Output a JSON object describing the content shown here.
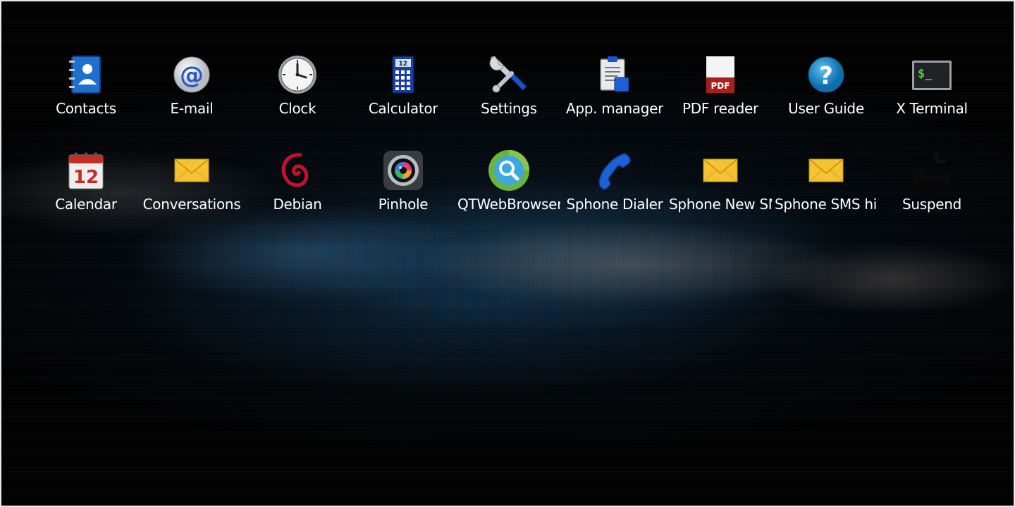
{
  "launcher": {
    "rows": [
      [
        {
          "label": "Contacts",
          "icon": "contacts-icon"
        },
        {
          "label": "E-mail",
          "icon": "email-at-icon"
        },
        {
          "label": "Clock",
          "icon": "clock-icon"
        },
        {
          "label": "Calculator",
          "icon": "calculator-icon",
          "icon_text": "12"
        },
        {
          "label": "Settings",
          "icon": "wrench-screwdriver-icon"
        },
        {
          "label": "App. manager",
          "icon": "clipboard-icon"
        },
        {
          "label": "PDF reader",
          "icon": "pdf-document-icon",
          "icon_text": "PDF"
        },
        {
          "label": "User Guide",
          "icon": "question-mark-icon",
          "icon_text": "?"
        },
        {
          "label": "X Terminal",
          "icon": "terminal-icon",
          "icon_text": "$_"
        }
      ],
      [
        {
          "label": "Calendar",
          "icon": "calendar-icon",
          "icon_text": "12"
        },
        {
          "label": "Conversations",
          "icon": "envelope-icon"
        },
        {
          "label": "Debian",
          "icon": "debian-swirl-icon"
        },
        {
          "label": "Pinhole",
          "icon": "camera-lens-icon"
        },
        {
          "label": "QTWebBrowser",
          "icon": "magnifier-globe-icon"
        },
        {
          "label": "Sphone Dialer",
          "icon": "phone-handset-icon"
        },
        {
          "label": "Sphone New SM-",
          "icon": "envelope-icon"
        },
        {
          "label": "Sphone SMS his-",
          "icon": "envelope-icon"
        },
        {
          "label": "Suspend",
          "icon": "bed-moon-icon"
        }
      ]
    ]
  },
  "colors": {
    "label_text": "#ffffff",
    "contacts_blue": "#1f6fd0",
    "pdf_red": "#a8201a",
    "help_blue": "#1d8fd6",
    "envelope_yellow": "#f5c233",
    "terminal_green": "#4fd13a",
    "browser_green": "#6ab43e",
    "phone_blue": "#1b62d6"
  }
}
